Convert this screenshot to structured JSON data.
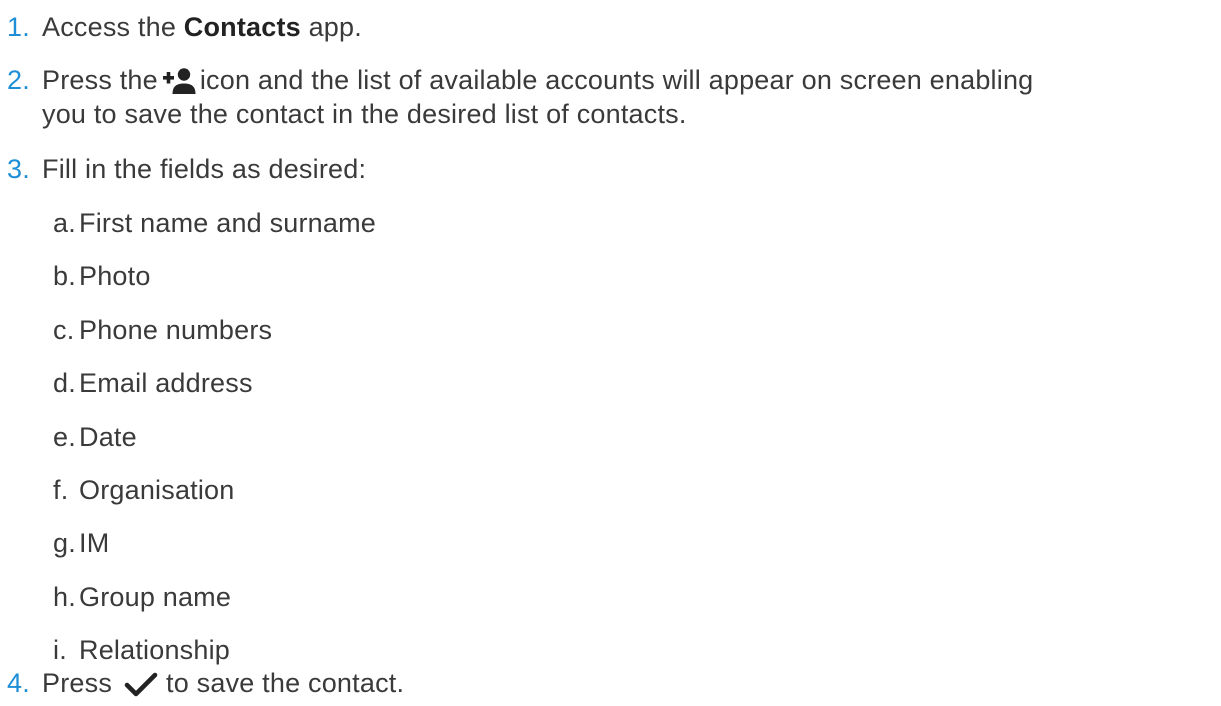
{
  "steps": [
    {
      "number": "1.",
      "before": "Access the ",
      "bold": "Contacts",
      "after": " app."
    },
    {
      "number": "2.",
      "before": "Press the",
      "icon": "add-contact-icon",
      "after": "icon and the list of available accounts will appear on screen enabling",
      "continuation": "you to save the contact in the desired list of contacts."
    },
    {
      "number": "3.",
      "text": "Fill in the fields as desired:",
      "subitems": [
        {
          "letter": "a.",
          "text": "First name and surname"
        },
        {
          "letter": "b.",
          "text": "Photo"
        },
        {
          "letter": "c.",
          "text": "Phone numbers"
        },
        {
          "letter": "d.",
          "text": "Email address"
        },
        {
          "letter": "e.",
          "text": "Date"
        },
        {
          "letter": "f.",
          "text": "Organisation"
        },
        {
          "letter": "g.",
          "text": "IM"
        },
        {
          "letter": "h.",
          "text": "Group name"
        },
        {
          "letter": "i.",
          "text": "Relationship"
        }
      ]
    },
    {
      "number": "4.",
      "before": "Press",
      "icon": "checkmark-icon",
      "after": "to save the contact."
    }
  ],
  "colors": {
    "number": "#1e8fd6",
    "text": "#3a3a3a",
    "icon": "#222222"
  }
}
